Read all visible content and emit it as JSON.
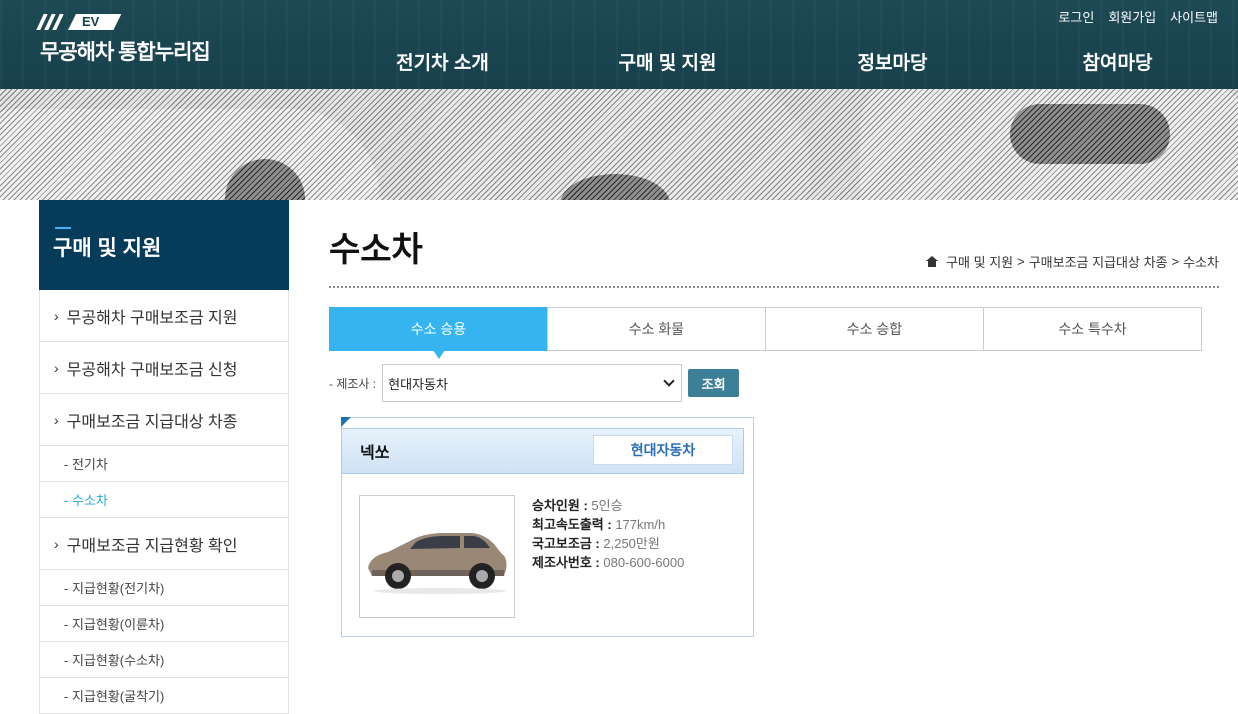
{
  "header": {
    "logo_badge": "EV",
    "logo_title": "무공해차 통합누리집",
    "util_links": [
      "로그인",
      "회원가입",
      "사이트맵"
    ],
    "gnb": [
      "전기차 소개",
      "구매 및 지원",
      "정보마당",
      "참여마당"
    ]
  },
  "sidebar": {
    "title": "구매 및 지원",
    "items": [
      {
        "label": "무공해차 구매보조금 지원"
      },
      {
        "label": "무공해차 구매보조금 신청"
      },
      {
        "label": "구매보조금 지급대상 차종"
      },
      {
        "label": "- 전기차"
      },
      {
        "label": "- 수소차"
      },
      {
        "label": "구매보조금 지급현황 확인"
      },
      {
        "label": "- 지급현황(전기차)"
      },
      {
        "label": "- 지급현황(이륜차)"
      },
      {
        "label": "- 지급현황(수소차)"
      },
      {
        "label": "- 지급현황(굴착기)"
      }
    ]
  },
  "main": {
    "title": "수소차",
    "breadcrumb": [
      "구매 및 지원",
      "구매보조금 지급대상 차종",
      "수소차"
    ],
    "tabs": [
      "수소 승용",
      "수소 화물",
      "수소 승합",
      "수소 특수차"
    ],
    "active_tab": 0,
    "filter": {
      "label": "- 제조사 :",
      "selected": "현대자동차",
      "button": "조회"
    },
    "vehicle": {
      "name": "넥쏘",
      "maker": "현대자동차",
      "specs": [
        {
          "label": "승차인원 :",
          "value": "5인승"
        },
        {
          "label": "최고속도출력 :",
          "value": "177km/h"
        },
        {
          "label": "국고보조금 :",
          "value": "2,250만원"
        },
        {
          "label": "제조사번호 :",
          "value": "080-600-6000"
        }
      ]
    }
  },
  "colors": {
    "header_bg": "#17404b",
    "sidebar_title_bg": "#063b5a",
    "active_tab": "#36b4f0",
    "search_button": "#3d7f96",
    "active_sub": "#2aa8df"
  }
}
